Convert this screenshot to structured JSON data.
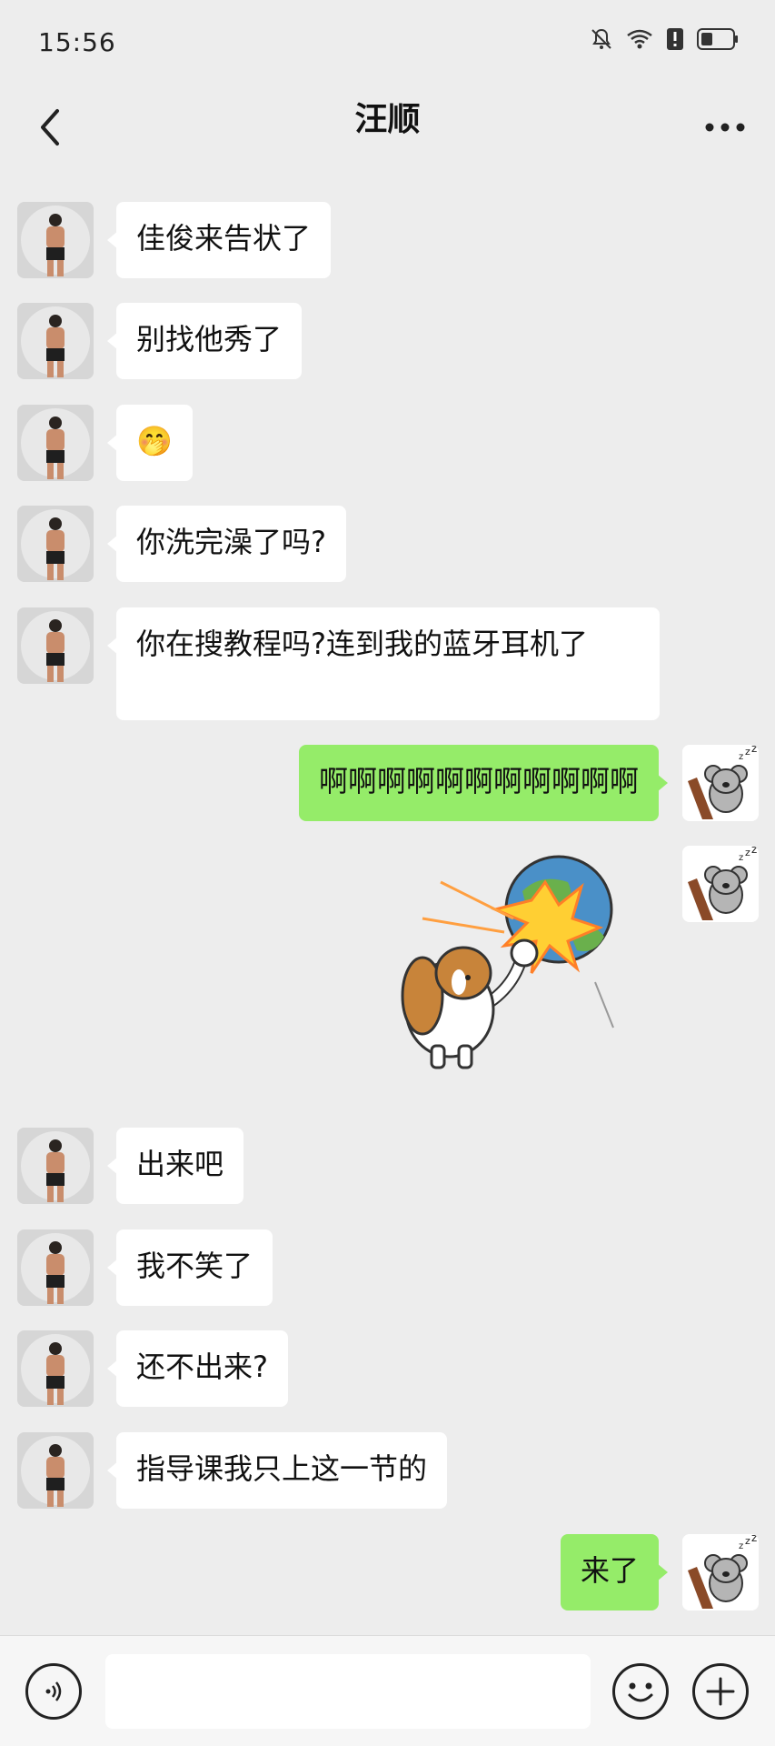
{
  "status_bar": {
    "time": "15:56",
    "icons": [
      "mute-bell-icon",
      "wifi-icon",
      "alert-icon",
      "battery-icon"
    ]
  },
  "nav": {
    "title": "汪顺",
    "back_icon": "chevron-left-icon",
    "more_icon": "more-dots-icon"
  },
  "messages": [
    {
      "side": "left",
      "text": "佳俊来告状了"
    },
    {
      "side": "left",
      "text": "别找他秀了"
    },
    {
      "side": "left",
      "text": "🤭"
    },
    {
      "side": "left",
      "text": "你洗完澡了吗?"
    },
    {
      "side": "left",
      "text": "你在搜教程吗?连到我的蓝牙耳机了"
    },
    {
      "side": "right",
      "text": "啊啊啊啊啊啊啊啊啊啊啊"
    },
    {
      "side": "right",
      "type": "sticker",
      "sticker": "dog-punching-earth-sticker"
    },
    {
      "side": "left",
      "text": "出来吧"
    },
    {
      "side": "left",
      "text": "我不笑了"
    },
    {
      "side": "left",
      "text": "还不出来?"
    },
    {
      "side": "left",
      "text": "指导课我只上这一节的"
    },
    {
      "side": "right",
      "text": "来了"
    }
  ],
  "input_bar": {
    "voice_icon": "voice-icon",
    "emoji_icon": "emoji-icon",
    "plus_icon": "plus-icon",
    "input_value": ""
  },
  "colors": {
    "background": "#ededed",
    "bubble_in": "#ffffff",
    "bubble_out": "#95ec69"
  }
}
